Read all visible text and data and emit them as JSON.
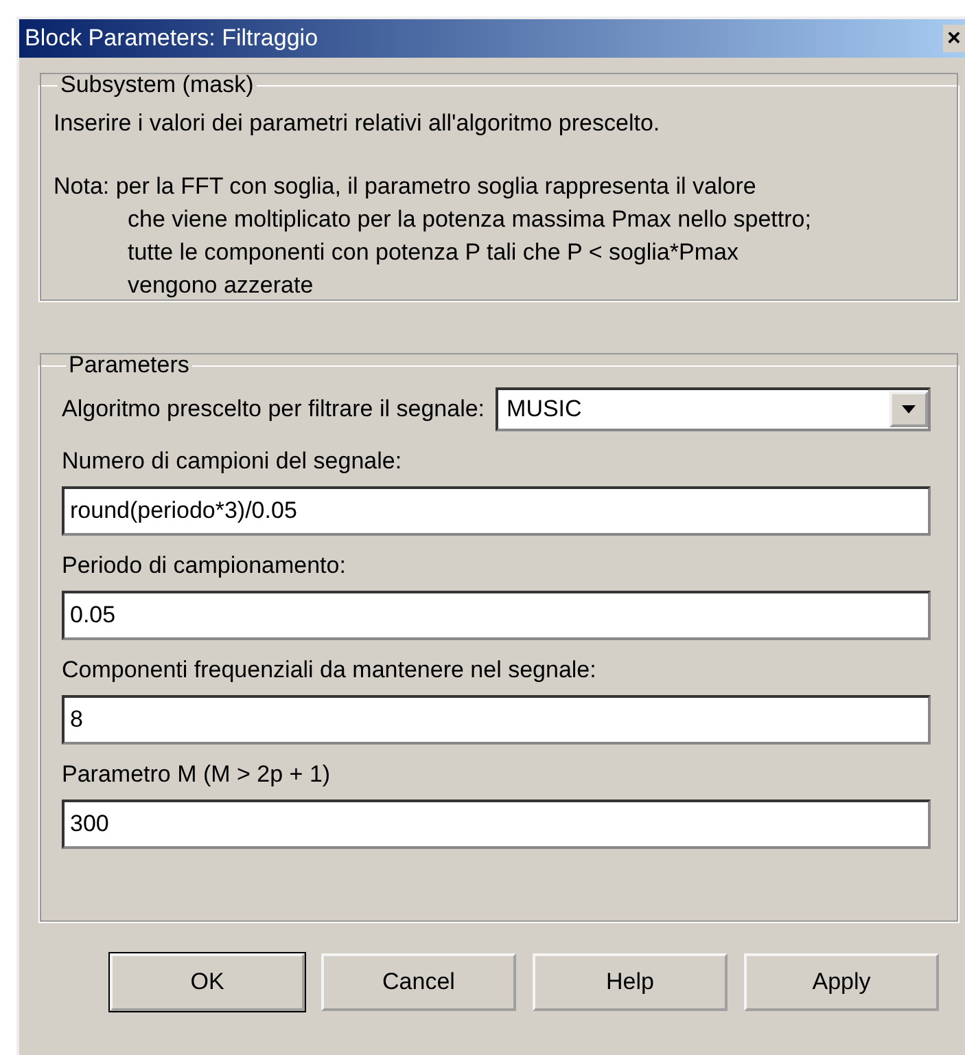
{
  "window": {
    "title": "Block Parameters: Filtraggio",
    "close": "×"
  },
  "description": {
    "title": "Subsystem (mask)",
    "text": "Inserire i valori dei parametri relativi all'algoritmo prescelto.",
    "note_lines": [
      "Nota: per la FFT con soglia, il parametro soglia rappresenta il valore",
      "che viene moltiplicato per la potenza massima Pmax nello spettro;",
      "tutte le componenti con potenza P tali che P < soglia*Pmax",
      "vengono azzerate"
    ]
  },
  "parameters": {
    "title": "Parameters",
    "fields": [
      {
        "kind": "dropdown",
        "label": "Algoritmo prescelto per filtrare il segnale:",
        "value": "MUSIC"
      },
      {
        "kind": "text",
        "label": "Numero di campioni del segnale:",
        "value": "round(periodo*3)/0.05"
      },
      {
        "kind": "text",
        "label": "Periodo di campionamento:",
        "value": "0.05"
      },
      {
        "kind": "text",
        "label": "Componenti frequenziali da mantenere nel segnale:",
        "value": "8"
      },
      {
        "kind": "text",
        "label": "Parametro M (M > 2p + 1)",
        "value": "300"
      }
    ]
  },
  "buttons": [
    {
      "label": "OK",
      "default": true
    },
    {
      "label": "Cancel",
      "default": false
    },
    {
      "label": "Help",
      "default": false
    },
    {
      "label": "Apply",
      "default": false
    }
  ]
}
